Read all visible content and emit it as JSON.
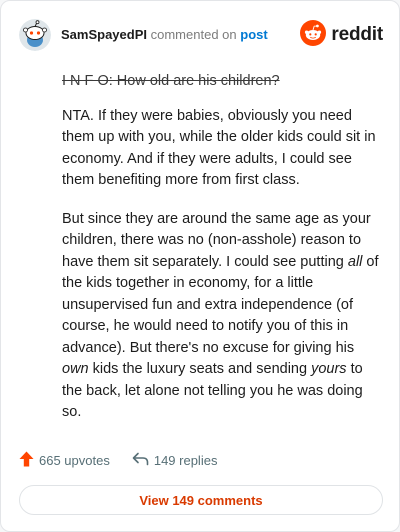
{
  "header": {
    "username": "SamSpayedPI",
    "action_text": "commented on",
    "target_text": "post",
    "brand_word": "reddit"
  },
  "comment": {
    "info_line": "I N F O: How old are his children?",
    "paragraph1": "NTA. If they were babies, obviously you need them up with you, while the older kids could sit in economy. And if they were adults, I could see them benefiting more from first class.",
    "paragraph2": {
      "part1": "But since they are around the same age as your children, there was no (non-asshole) reason to have them sit separately. I could see putting ",
      "em1": "all",
      "part2": " of the kids together in economy, for a little unsupervised fun and extra independence (of course, he would need to notify you of this in advance). But there's no excuse for giving his ",
      "em2": "own",
      "part3": " kids the luxury seats and sending ",
      "em3": "yours",
      "part4": " to the back, let alone not telling you he was doing so."
    }
  },
  "actions": {
    "upvotes_label": "665 upvotes",
    "replies_label": "149 replies"
  },
  "view_button": {
    "label": "View 149 comments"
  },
  "icons": [
    "snoo-avatar-icon",
    "reddit-logo-icon",
    "upvote-arrow-icon",
    "reply-arrow-icon"
  ],
  "colors": {
    "upvote": "#ff4500",
    "brand": "#ff4500",
    "link": "#0079d3",
    "button_text": "#d93a00"
  }
}
